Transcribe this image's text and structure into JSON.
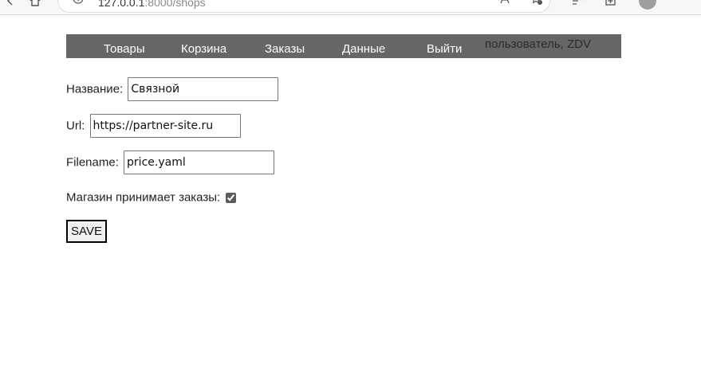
{
  "browser": {
    "url_host": "127.0.0.1",
    "url_port": ":8000",
    "url_path": "/shops"
  },
  "nav": {
    "items": [
      {
        "label": "Товары"
      },
      {
        "label": "Корзина"
      },
      {
        "label": "Заказы"
      },
      {
        "label": "Данные"
      },
      {
        "label": "Выйти"
      }
    ],
    "user_text": "пользователь, ZDV",
    "background": "#666666"
  },
  "form": {
    "name_label": "Название:",
    "name_value": "Связной",
    "url_label": "Url:",
    "url_value": "https://partner-site.ru",
    "filename_label": "Filename:",
    "filename_value": "price.yaml",
    "accepts_orders_label": "Магазин принимает заказы:",
    "accepts_orders_checked": true,
    "save_label": "SAVE"
  }
}
